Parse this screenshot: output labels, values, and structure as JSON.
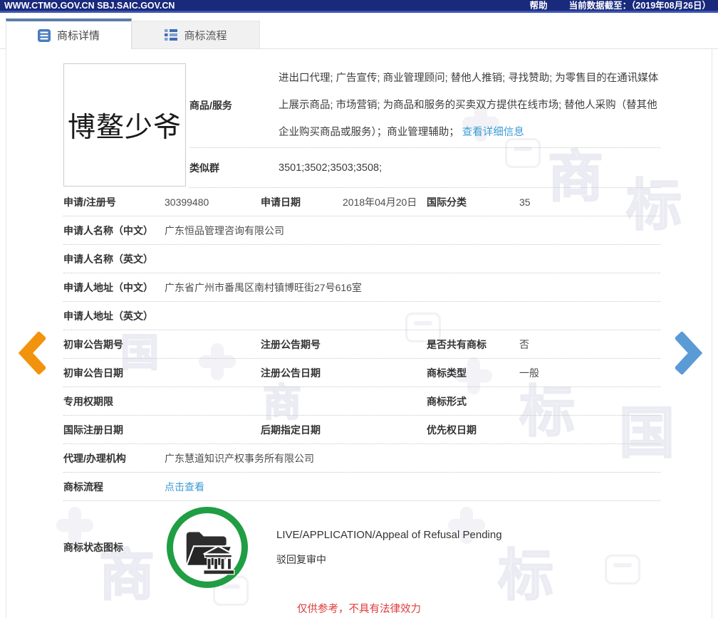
{
  "topbar": {
    "site": "WWW.CTMO.GOV.CN SBJ.SAIC.GOV.CN",
    "help": "帮助",
    "data_as_of": "当前数据截至：（2019年08月26日）"
  },
  "tabs": [
    {
      "label": "商标详情",
      "active": true
    },
    {
      "label": "商标流程",
      "active": false
    }
  ],
  "trademark": {
    "name": "博鳌少爷"
  },
  "fields": {
    "goods_services": {
      "label": "商品/服务",
      "value": "进出口代理; 广告宣传; 商业管理顾问; 替他人推销; 寻找赞助; 为零售目的在通讯媒体上展示商品; 市场营销; 为商品和服务的买卖双方提供在线市场; 替他人采购（替其他企业购买商品或服务）；商业管理辅助；",
      "link": "查看详细信息"
    },
    "similar_group": {
      "label": "类似群",
      "value": "3501;3502;3503;3508;"
    },
    "app_no": {
      "label": "申请/注册号",
      "value": "30399480"
    },
    "app_date": {
      "label": "申请日期",
      "value": "2018年04月20日"
    },
    "intl_class": {
      "label": "国际分类",
      "value": "35"
    },
    "applicant_cn": {
      "label": "申请人名称（中文）",
      "value": "广东恒品管理咨询有限公司"
    },
    "applicant_en": {
      "label": "申请人名称（英文）",
      "value": ""
    },
    "address_cn": {
      "label": "申请人地址（中文）",
      "value": "广东省广州市番禺区南村镇博旺街27号616室"
    },
    "address_en": {
      "label": "申请人地址（英文）",
      "value": ""
    },
    "prelim_no": {
      "label": "初审公告期号",
      "value": ""
    },
    "reg_pub_no": {
      "label": "注册公告期号",
      "value": ""
    },
    "shared": {
      "label": "是否共有商标",
      "value": "否"
    },
    "prelim_date": {
      "label": "初审公告日期",
      "value": ""
    },
    "reg_pub_date": {
      "label": "注册公告日期",
      "value": ""
    },
    "tm_type": {
      "label": "商标类型",
      "value": "一般"
    },
    "exclusive_period": {
      "label": "专用权期限",
      "value": ""
    },
    "tm_form": {
      "label": "商标形式",
      "value": ""
    },
    "intl_reg_date": {
      "label": "国际注册日期",
      "value": ""
    },
    "later_designation_date": {
      "label": "后期指定日期",
      "value": ""
    },
    "priority_date": {
      "label": "优先权日期",
      "value": ""
    },
    "agency": {
      "label": "代理/办理机构",
      "value": "广东慧道知识产权事务所有限公司"
    },
    "tm_flow": {
      "label": "商标流程",
      "link": "点击查看"
    },
    "status": {
      "label": "商标状态图标",
      "status_en": "LIVE/APPLICATION/Appeal of Refusal Pending",
      "status_cn": "驳回复审中"
    }
  },
  "footer": {
    "disclaimer": "仅供参考，不具有法律效力"
  },
  "watermark": {
    "glyphs": [
      "商",
      "标",
      "国",
      "商",
      "标",
      "国",
      "商",
      "标"
    ]
  },
  "colors": {
    "topbar_navy": "#19297c",
    "tab_accent": "#5b7ca6",
    "link_blue": "#3b9bd5",
    "arrow_orange": "#f2930d",
    "arrow_blue": "#5b9bd5",
    "status_green": "#1f9e43",
    "disclaimer_red": "#e03b3b"
  }
}
